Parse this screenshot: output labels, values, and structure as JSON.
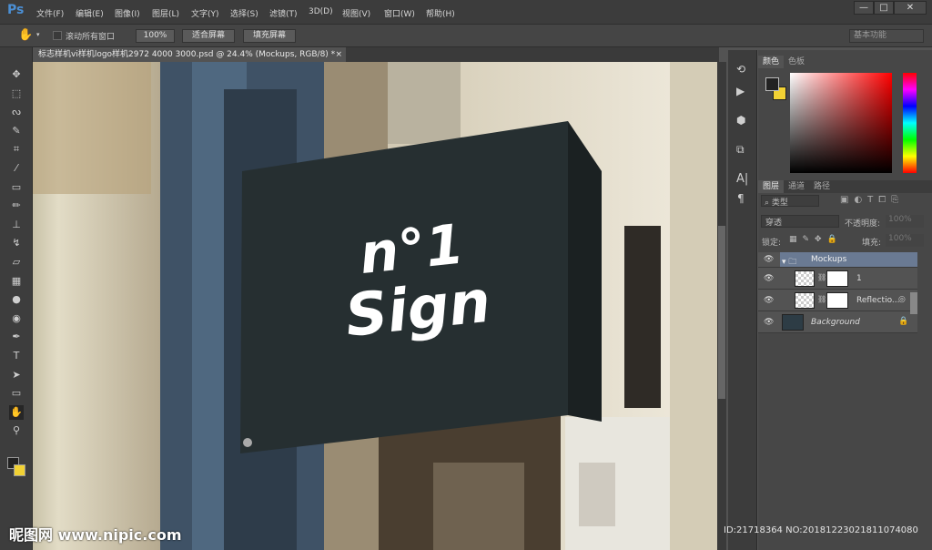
{
  "app": {
    "logo": "Ps"
  },
  "menu": [
    "文件(F)",
    "编辑(E)",
    "图像(I)",
    "图层(L)",
    "文字(Y)",
    "选择(S)",
    "滤镜(T)",
    "3D(D)",
    "视图(V)",
    "窗口(W)",
    "帮助(H)"
  ],
  "window_controls": {
    "minimize": "—",
    "maximize": "□",
    "close": "✕"
  },
  "options": {
    "scroll_all_label": "滚动所有窗口",
    "btn_100": "100%",
    "btn_fit": "适合屏幕",
    "btn_fill": "填充屏幕",
    "workspace": "基本功能"
  },
  "document": {
    "tab_title": "标志样机vi样机logo样机2972 4000 3000.psd @ 24.4% (Mockups, RGB/8) *",
    "close": "×"
  },
  "sign": {
    "line1": "n°1",
    "line2": "Sign"
  },
  "color_panel": {
    "tabs": [
      "颜色",
      "色板"
    ],
    "fg": "#222222",
    "bg": "#f2d234"
  },
  "layers_panel": {
    "tabs": [
      "图层",
      "通道",
      "路径"
    ],
    "filter": "类型",
    "blend_mode": "穿透",
    "opacity_label": "不透明度:",
    "opacity": "100%",
    "lock_label": "锁定:",
    "fill_label": "填充:",
    "fill": "100%",
    "layers": [
      {
        "name": "Mockups",
        "type": "group",
        "selected": true
      },
      {
        "name": "1",
        "type": "smart"
      },
      {
        "name": "Reflectio...",
        "type": "smart"
      },
      {
        "name": "Background",
        "type": "background",
        "locked": true
      }
    ]
  },
  "watermark": {
    "text": "昵图网 www.nipic.com",
    "id": "ID:21718364 NO:20181223021811074080"
  }
}
